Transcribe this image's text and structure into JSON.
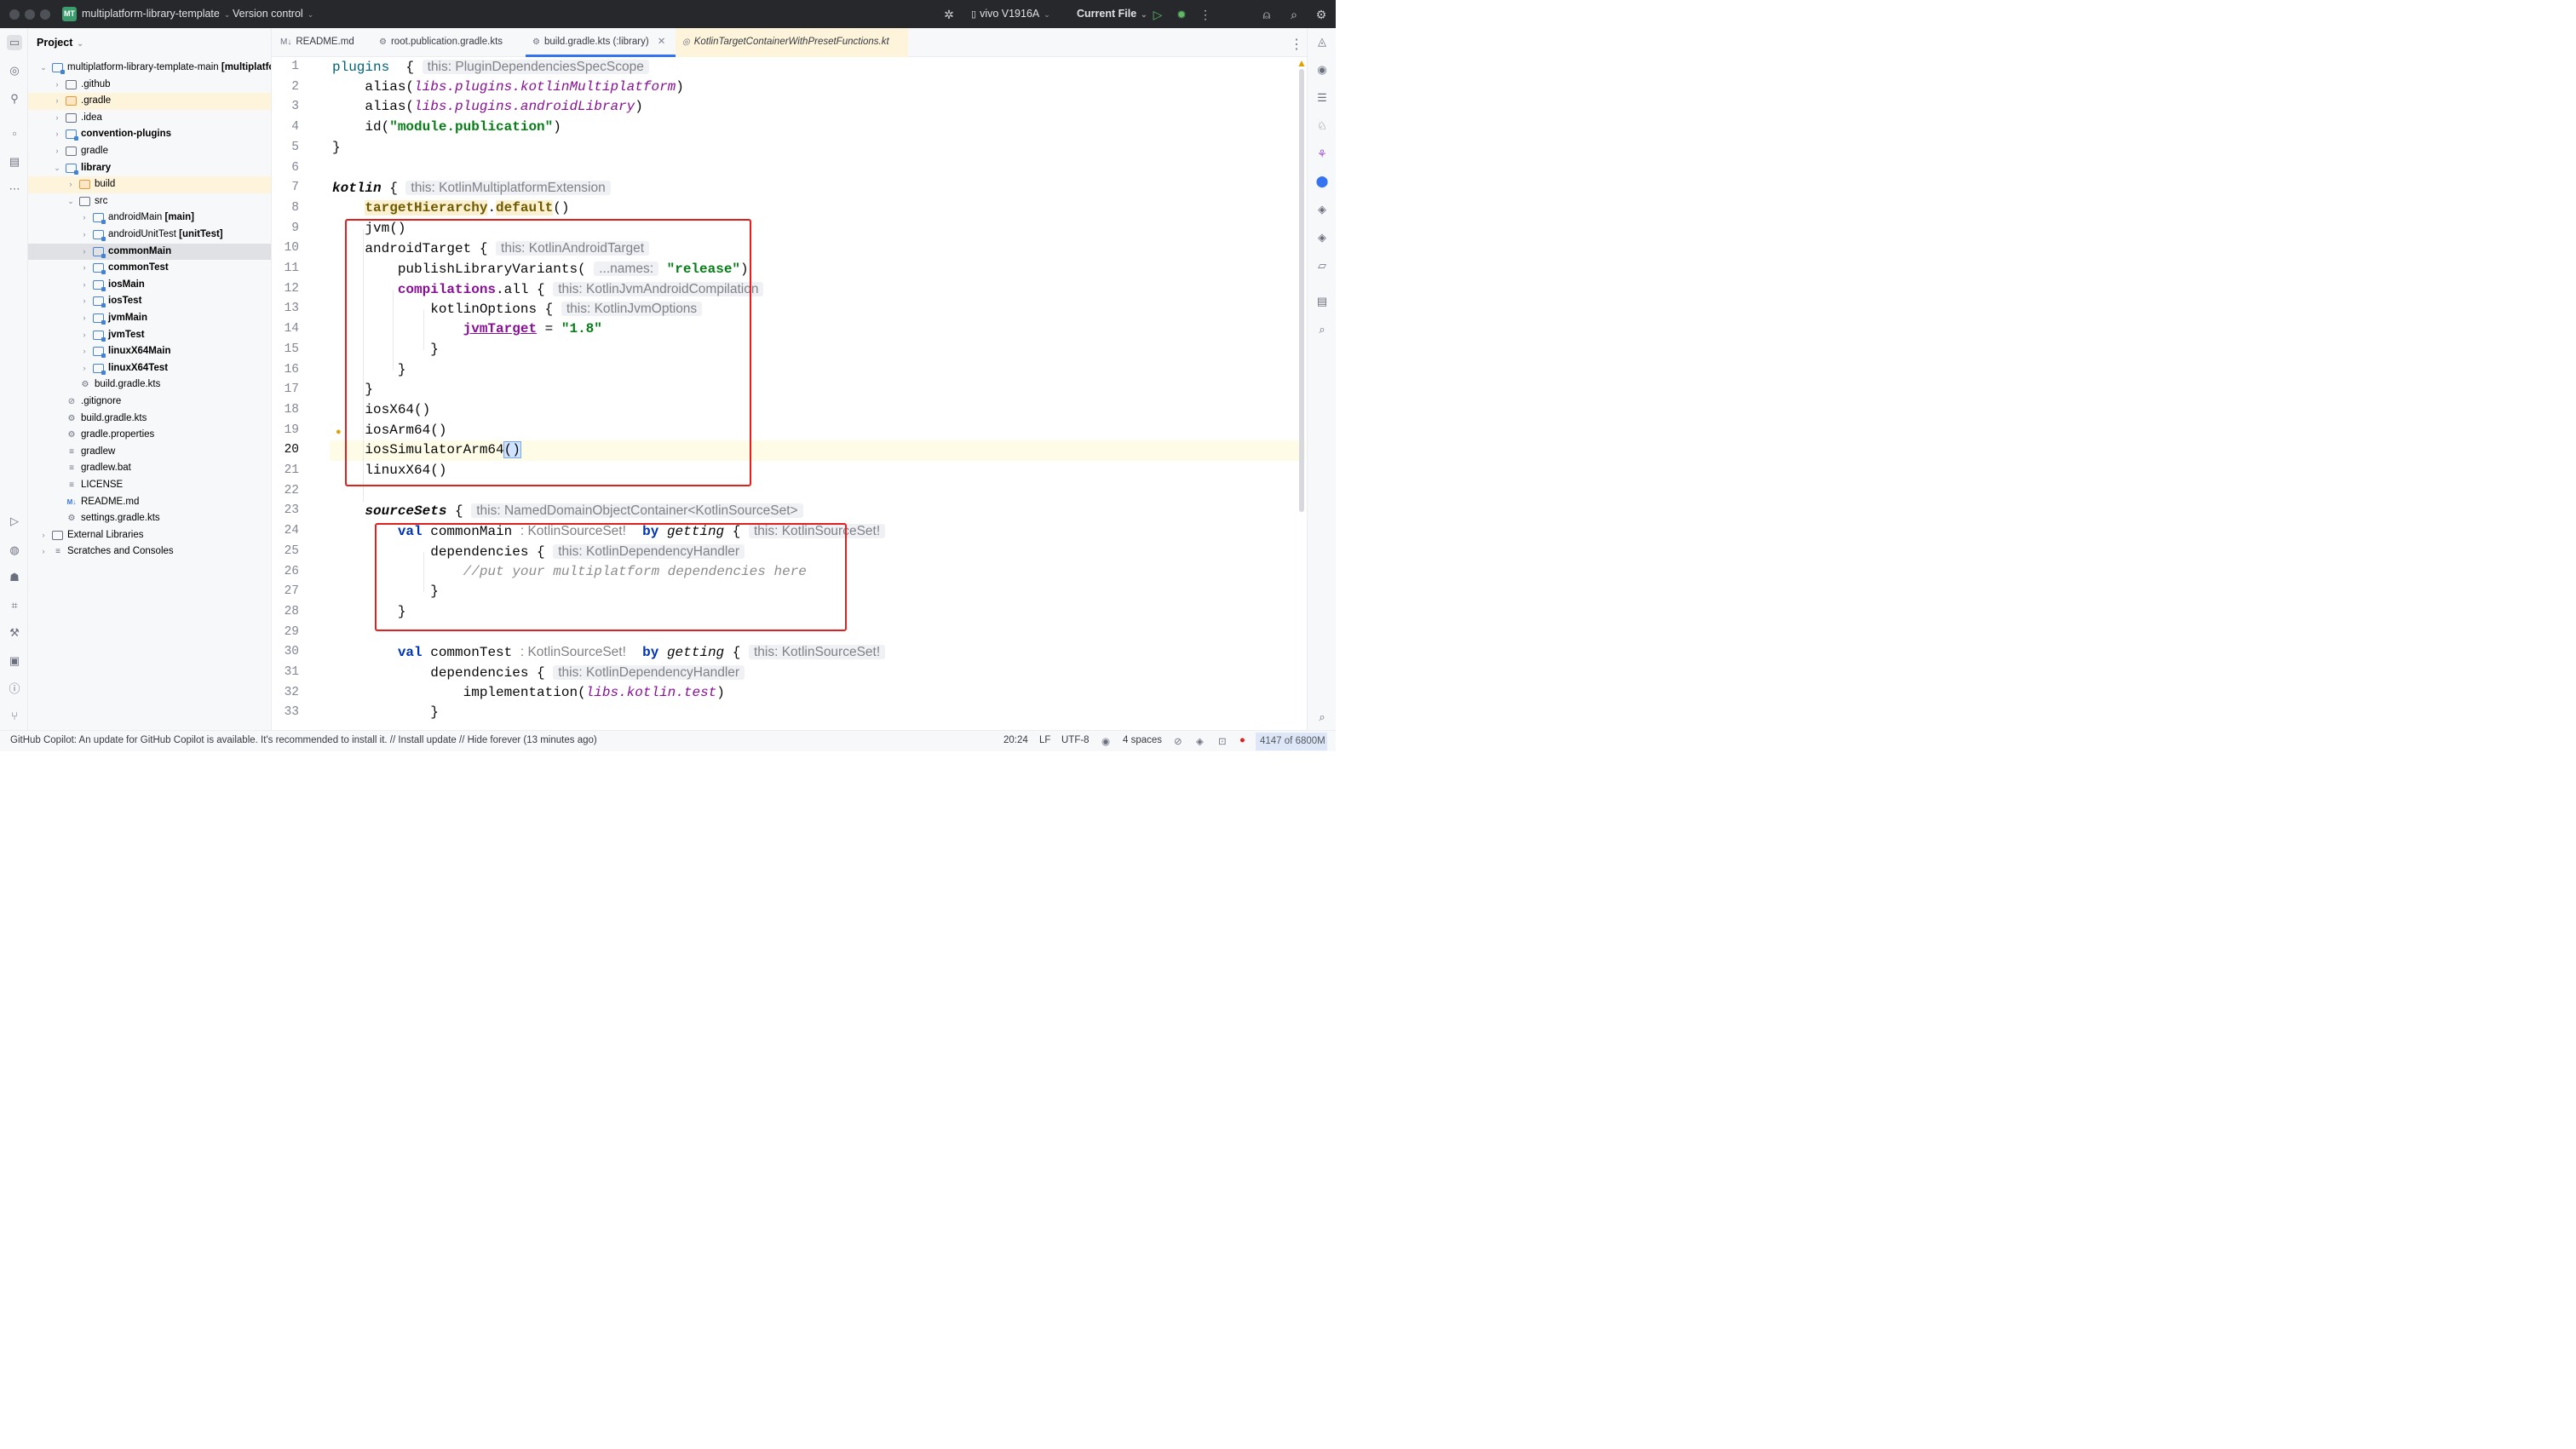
{
  "titlebar": {
    "project_badge": "MT",
    "project_name": "multiplatform-library-template",
    "vcs": "Version control",
    "device": "vivo V1916A",
    "run_config": "Current File"
  },
  "project": {
    "header": "Project",
    "tree": [
      {
        "label": "multiplatform-library-template-main",
        "suffix": "[multiplatfo",
        "depth": 0,
        "arrow": "open",
        "icon": "module",
        "bold": false
      },
      {
        "label": ".github",
        "depth": 1,
        "arrow": "closed",
        "icon": "folder"
      },
      {
        "label": ".gradle",
        "depth": 1,
        "arrow": "closed",
        "icon": "folder-orange",
        "highlight": true
      },
      {
        "label": ".idea",
        "depth": 1,
        "arrow": "closed",
        "icon": "folder"
      },
      {
        "label": "convention-plugins",
        "depth": 1,
        "arrow": "closed",
        "icon": "module",
        "bold": true
      },
      {
        "label": "gradle",
        "depth": 1,
        "arrow": "closed",
        "icon": "folder"
      },
      {
        "label": "library",
        "depth": 1,
        "arrow": "open",
        "icon": "module",
        "bold": true
      },
      {
        "label": "build",
        "depth": 2,
        "arrow": "closed",
        "icon": "folder-orange",
        "highlight": true
      },
      {
        "label": "src",
        "depth": 2,
        "arrow": "open",
        "icon": "folder"
      },
      {
        "label": "androidMain",
        "suffix": "[main]",
        "depth": 3,
        "arrow": "closed",
        "icon": "module"
      },
      {
        "label": "androidUnitTest",
        "suffix": "[unitTest]",
        "depth": 3,
        "arrow": "closed",
        "icon": "module"
      },
      {
        "label": "commonMain",
        "depth": 3,
        "arrow": "closed",
        "icon": "module",
        "bold": true,
        "selected": true
      },
      {
        "label": "commonTest",
        "depth": 3,
        "arrow": "closed",
        "icon": "module",
        "bold": true
      },
      {
        "label": "iosMain",
        "depth": 3,
        "arrow": "closed",
        "icon": "module",
        "bold": true
      },
      {
        "label": "iosTest",
        "depth": 3,
        "arrow": "closed",
        "icon": "module",
        "bold": true
      },
      {
        "label": "jvmMain",
        "depth": 3,
        "arrow": "closed",
        "icon": "module",
        "bold": true
      },
      {
        "label": "jvmTest",
        "depth": 3,
        "arrow": "closed",
        "icon": "module",
        "bold": true
      },
      {
        "label": "linuxX64Main",
        "depth": 3,
        "arrow": "closed",
        "icon": "module",
        "bold": true
      },
      {
        "label": "linuxX64Test",
        "depth": 3,
        "arrow": "closed",
        "icon": "module",
        "bold": true
      },
      {
        "label": "build.gradle.kts",
        "depth": 2,
        "arrow": "none",
        "icon": "gradle"
      },
      {
        "label": ".gitignore",
        "depth": 1,
        "arrow": "none",
        "icon": "ignore"
      },
      {
        "label": "build.gradle.kts",
        "depth": 1,
        "arrow": "none",
        "icon": "gradle"
      },
      {
        "label": "gradle.properties",
        "depth": 1,
        "arrow": "none",
        "icon": "settings"
      },
      {
        "label": "gradlew",
        "depth": 1,
        "arrow": "none",
        "icon": "text"
      },
      {
        "label": "gradlew.bat",
        "depth": 1,
        "arrow": "none",
        "icon": "text"
      },
      {
        "label": "LICENSE",
        "depth": 1,
        "arrow": "none",
        "icon": "text"
      },
      {
        "label": "README.md",
        "depth": 1,
        "arrow": "none",
        "icon": "md"
      },
      {
        "label": "settings.gradle.kts",
        "depth": 1,
        "arrow": "none",
        "icon": "gradle"
      },
      {
        "label": "External Libraries",
        "depth": 0,
        "arrow": "closed",
        "icon": "library"
      },
      {
        "label": "Scratches and Consoles",
        "depth": 0,
        "arrow": "closed",
        "icon": "scratch"
      }
    ]
  },
  "tabs": [
    {
      "label": "README.md",
      "icon": "M↓"
    },
    {
      "label": "root.publication.gradle.kts",
      "icon": "⚙"
    },
    {
      "label": "build.gradle.kts (:library)",
      "icon": "⚙",
      "active": true
    },
    {
      "label": "KotlinTargetContainerWithPresetFunctions.kt",
      "icon": "◎",
      "italic": true
    }
  ],
  "editor": {
    "current_line": 20,
    "lines": [
      {
        "n": "1",
        "tokens": [
          [
            "fn",
            "plugins"
          ],
          [
            "",
            "  { "
          ],
          [
            "hint",
            "this: PluginDependenciesSpecScope"
          ]
        ]
      },
      {
        "n": "2",
        "tokens": [
          [
            "",
            "    alias("
          ],
          [
            "ita",
            "libs.plugins.kotlinMultiplatform"
          ],
          [
            "",
            ")"
          ]
        ]
      },
      {
        "n": "3",
        "tokens": [
          [
            "",
            "    alias("
          ],
          [
            "ita",
            "libs.plugins.androidLibrary"
          ],
          [
            "",
            ")"
          ]
        ]
      },
      {
        "n": "4",
        "tokens": [
          [
            "",
            "    id("
          ],
          [
            "str",
            "\"module.publication\""
          ],
          [
            "",
            ")"
          ]
        ]
      },
      {
        "n": "5",
        "tokens": [
          [
            "",
            "}"
          ]
        ]
      },
      {
        "n": "6",
        "tokens": []
      },
      {
        "n": "7",
        "tokens": [
          [
            "itab",
            "kotlin"
          ],
          [
            "",
            " { "
          ],
          [
            "hint",
            "this: KotlinMultiplatformExtension"
          ]
        ]
      },
      {
        "n": "8",
        "tokens": [
          [
            "",
            "    "
          ],
          [
            "ext",
            "targetHierarchy"
          ],
          [
            "",
            "."
          ],
          [
            "ext",
            "default"
          ],
          [
            "",
            "()"
          ]
        ]
      },
      {
        "n": "9",
        "tokens": [
          [
            "",
            "    jvm()"
          ]
        ]
      },
      {
        "n": "10",
        "tokens": [
          [
            "",
            "    androidTarget { "
          ],
          [
            "hint",
            "this: KotlinAndroidTarget"
          ]
        ]
      },
      {
        "n": "11",
        "tokens": [
          [
            "",
            "        publishLibraryVariants( "
          ],
          [
            "hint",
            "...names:"
          ],
          [
            "",
            " "
          ],
          [
            "str",
            "\"release\""
          ],
          [
            "",
            ")"
          ]
        ]
      },
      {
        "n": "12",
        "tokens": [
          [
            "",
            "        "
          ],
          [
            "prop",
            "compilations"
          ],
          [
            "",
            ".all { "
          ],
          [
            "hint",
            "this: KotlinJvmAndroidCompilation"
          ]
        ]
      },
      {
        "n": "13",
        "tokens": [
          [
            "",
            "            kotlinOptions { "
          ],
          [
            "hint",
            "this: KotlinJvmOptions"
          ]
        ]
      },
      {
        "n": "14",
        "tokens": [
          [
            "",
            "                "
          ],
          [
            "propu",
            "jvmTarget"
          ],
          [
            "",
            " = "
          ],
          [
            "str",
            "\"1.8\""
          ]
        ]
      },
      {
        "n": "15",
        "tokens": [
          [
            "",
            "            }"
          ]
        ]
      },
      {
        "n": "16",
        "tokens": [
          [
            "",
            "        }"
          ]
        ]
      },
      {
        "n": "17",
        "tokens": [
          [
            "",
            "    }"
          ]
        ]
      },
      {
        "n": "18",
        "tokens": [
          [
            "",
            "    iosX64()"
          ]
        ]
      },
      {
        "n": "19",
        "tokens": [
          [
            "",
            "    iosArm64()"
          ]
        ]
      },
      {
        "n": "20",
        "tokens": [
          [
            "",
            "    iosSimulatorArm64"
          ],
          [
            "brace",
            "()"
          ]
        ]
      },
      {
        "n": "21",
        "tokens": [
          [
            "",
            "    linuxX64()"
          ]
        ]
      },
      {
        "n": "22",
        "tokens": []
      },
      {
        "n": "23",
        "tokens": [
          [
            "",
            "    "
          ],
          [
            "itab",
            "sourceSets"
          ],
          [
            "",
            " { "
          ],
          [
            "hint",
            "this: NamedDomainObjectContainer<KotlinSourceSet>"
          ]
        ]
      },
      {
        "n": "24",
        "tokens": [
          [
            "",
            "        "
          ],
          [
            "kw",
            "val"
          ],
          [
            "",
            " commonMain "
          ],
          [
            "hint2",
            ": KotlinSourceSet!"
          ],
          [
            "",
            "  "
          ],
          [
            "kw",
            "by"
          ],
          [
            "",
            " "
          ],
          [
            "itb",
            "getting"
          ],
          [
            "",
            " { "
          ],
          [
            "hint",
            "this: KotlinSourceSet!"
          ]
        ]
      },
      {
        "n": "25",
        "tokens": [
          [
            "",
            "            dependencies { "
          ],
          [
            "hint",
            "this: KotlinDependencyHandler"
          ]
        ]
      },
      {
        "n": "26",
        "tokens": [
          [
            "",
            "                "
          ],
          [
            "cmt",
            "//put your multiplatform dependencies here"
          ]
        ]
      },
      {
        "n": "27",
        "tokens": [
          [
            "",
            "            }"
          ]
        ]
      },
      {
        "n": "28",
        "tokens": [
          [
            "",
            "        }"
          ]
        ]
      },
      {
        "n": "29",
        "tokens": []
      },
      {
        "n": "30",
        "tokens": [
          [
            "",
            "        "
          ],
          [
            "kw",
            "val"
          ],
          [
            "",
            " commonTest "
          ],
          [
            "hint2",
            ": KotlinSourceSet!"
          ],
          [
            "",
            "  "
          ],
          [
            "kw",
            "by"
          ],
          [
            "",
            " "
          ],
          [
            "itb",
            "getting"
          ],
          [
            "",
            " { "
          ],
          [
            "hint",
            "this: KotlinSourceSet!"
          ]
        ]
      },
      {
        "n": "31",
        "tokens": [
          [
            "",
            "            dependencies { "
          ],
          [
            "hint",
            "this: KotlinDependencyHandler"
          ]
        ]
      },
      {
        "n": "32",
        "tokens": [
          [
            "",
            "                implementation("
          ],
          [
            "ita",
            "libs.kotlin.test"
          ],
          [
            "",
            ")"
          ]
        ]
      },
      {
        "n": "33",
        "tokens": [
          [
            "",
            "            }"
          ]
        ]
      }
    ]
  },
  "statusbar": {
    "message": "GitHub Copilot: An update for GitHub Copilot is available. It's recommended to install it. // Install update // Hide forever (13 minutes ago)",
    "position": "20:24",
    "line_sep": "LF",
    "encoding": "UTF-8",
    "indent": "4 spaces",
    "memory": "4147 of 6800M"
  },
  "colors": {
    "highlight_box": "#e0201e",
    "accent": "#3574f0"
  }
}
